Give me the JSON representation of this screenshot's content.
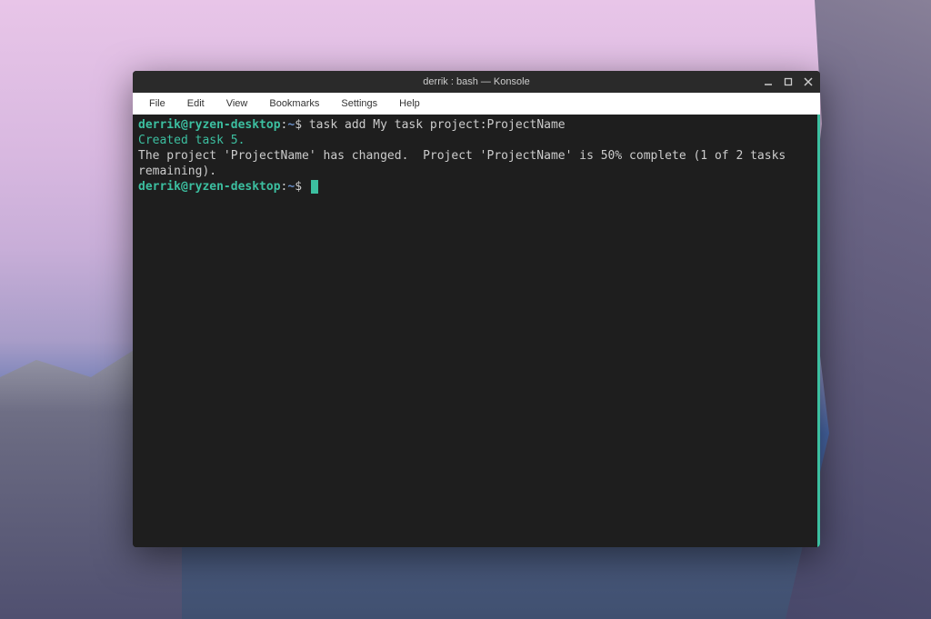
{
  "window": {
    "title": "derrik : bash — Konsole"
  },
  "menubar": {
    "items": [
      "File",
      "Edit",
      "View",
      "Bookmarks",
      "Settings",
      "Help"
    ]
  },
  "terminal": {
    "prompt": {
      "user_host": "derrik@ryzen-desktop",
      "separator": ":",
      "path": "~",
      "symbol": "$"
    },
    "command1": "task add My task project:ProjectName",
    "output_created": "Created task 5.",
    "output_project": "The project 'ProjectName' has changed.  Project 'ProjectName' is 50% complete (1 of 2 tasks remaining).",
    "colors": {
      "background": "#1e1e1e",
      "prompt_user": "#3cbfa0",
      "prompt_path": "#6a8fc8",
      "text": "#cccccc",
      "created": "#3cbfa0",
      "cursor": "#3cbfa0",
      "scrollbar": "#3cbfa0"
    }
  }
}
